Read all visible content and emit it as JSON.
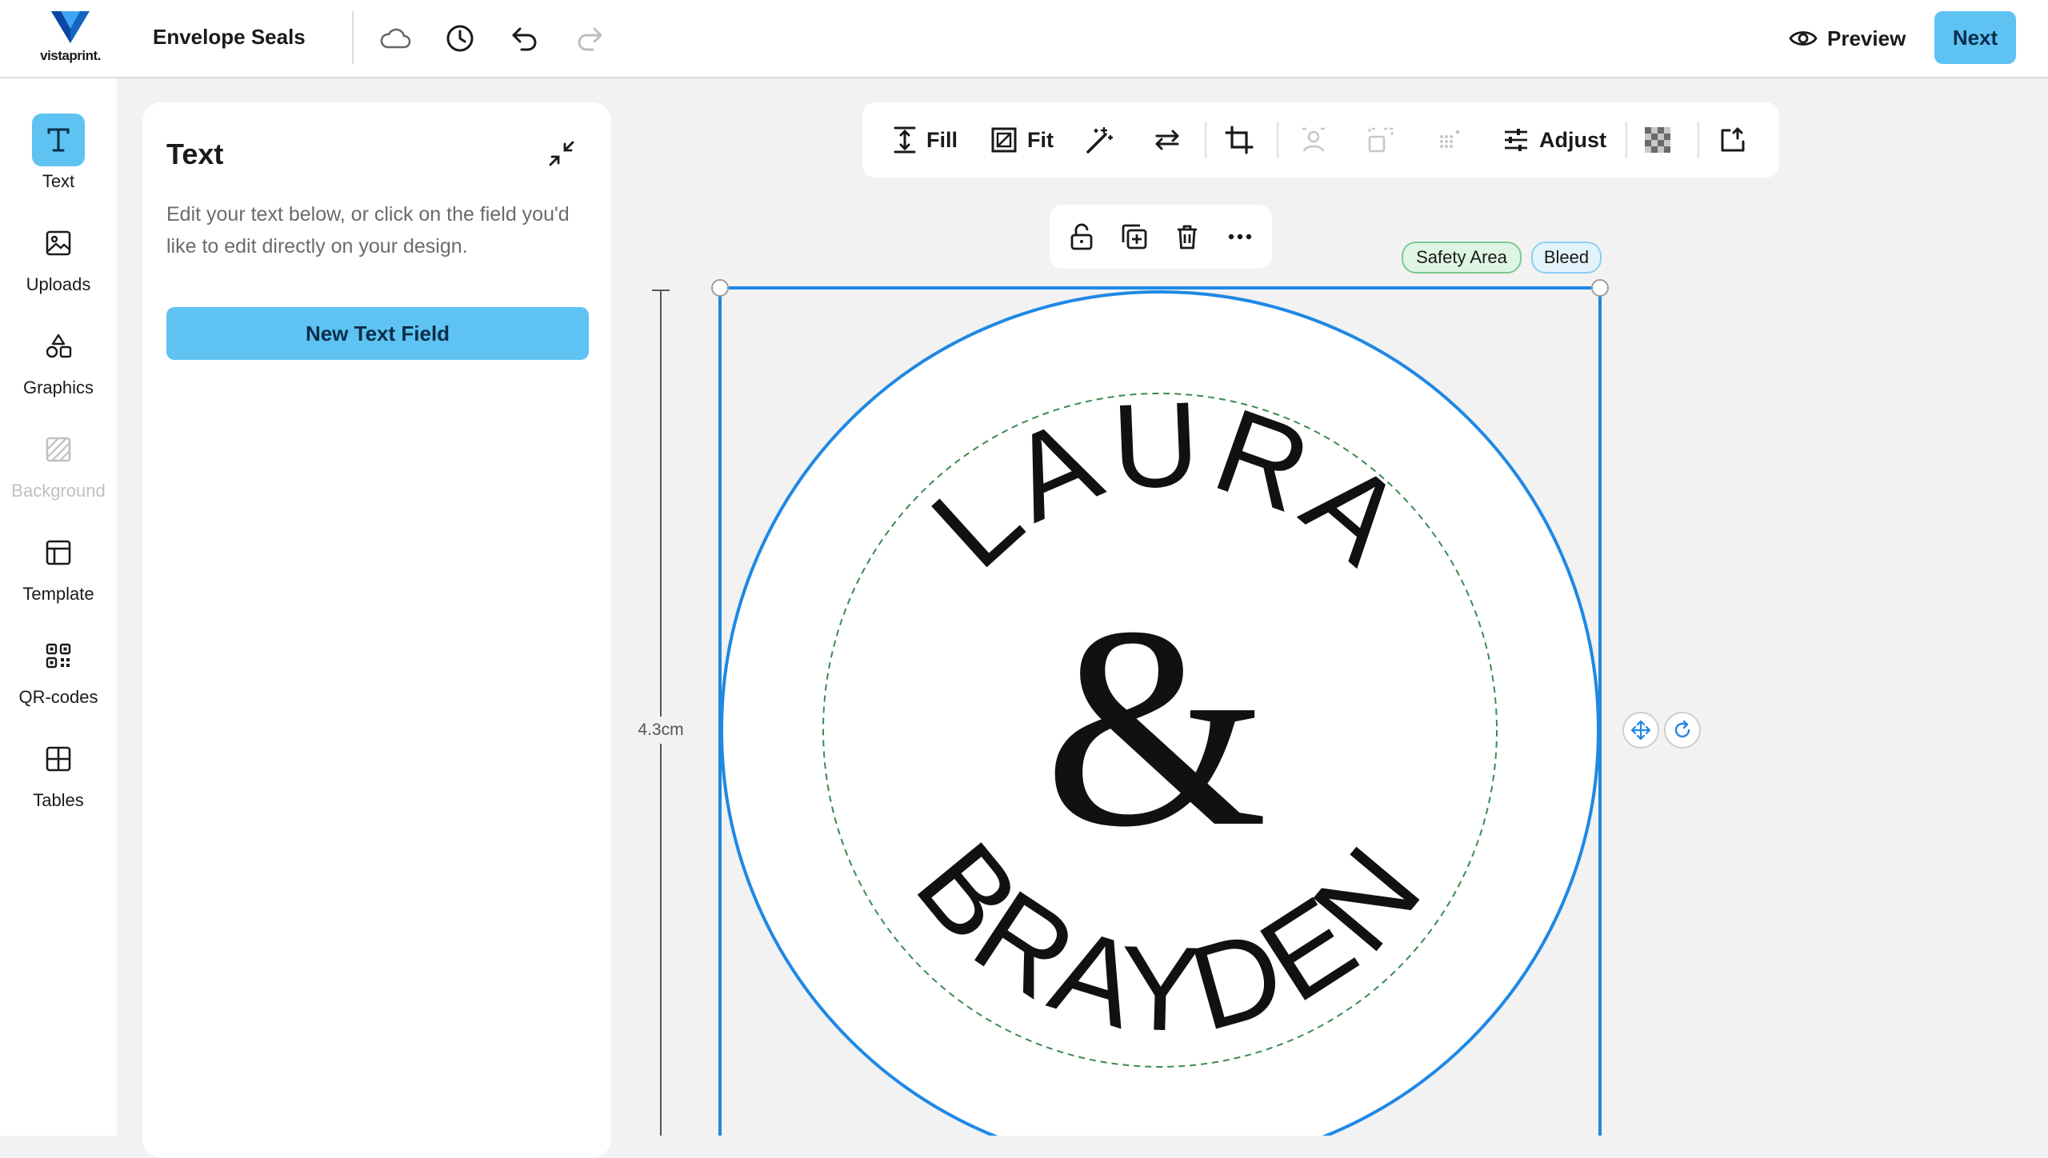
{
  "app": {
    "logo_text": "vistaprint.",
    "document_title": "Envelope Seals",
    "preview_label": "Preview",
    "next_label": "Next"
  },
  "rail": {
    "items": [
      {
        "label": "Text",
        "icon": "text-icon",
        "active": true,
        "disabled": false
      },
      {
        "label": "Uploads",
        "icon": "image-icon",
        "active": false,
        "disabled": false
      },
      {
        "label": "Graphics",
        "icon": "shapes-icon",
        "active": false,
        "disabled": false
      },
      {
        "label": "Background",
        "icon": "background-icon",
        "active": false,
        "disabled": true
      },
      {
        "label": "Template",
        "icon": "template-icon",
        "active": false,
        "disabled": false
      },
      {
        "label": "QR-codes",
        "icon": "qr-code-icon",
        "active": false,
        "disabled": false
      },
      {
        "label": "Tables",
        "icon": "table-icon",
        "active": false,
        "disabled": false
      }
    ]
  },
  "panel": {
    "title": "Text",
    "description": "Edit your text below, or click on the field you'd like to edit directly on your design.",
    "new_text_button": "New Text Field"
  },
  "image_toolbar": {
    "fill_label": "Fill",
    "fit_label": "Fit",
    "adjust_label": "Adjust"
  },
  "canvas": {
    "safety_area_label": "Safety Area",
    "bleed_label": "Bleed",
    "height_label": "4.3cm",
    "design_text_top": "LAURA",
    "design_text_center": "&",
    "design_text_bottom": "BRAYDEN"
  },
  "colors": {
    "accent": "#5ec3f2",
    "selection": "#1e88e5",
    "safety_line": "#3c8a50"
  }
}
